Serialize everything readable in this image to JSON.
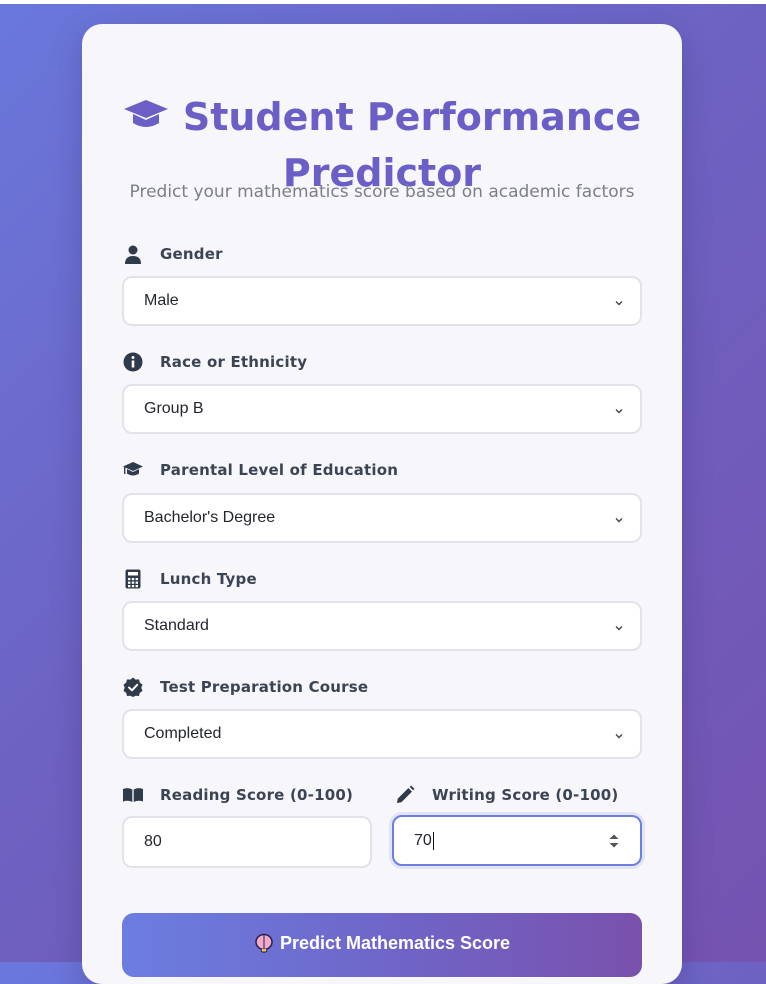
{
  "header": {
    "title_line1": "Student Performance",
    "title_line2": "Predictor",
    "title_icon": "graduation-cap-icon",
    "subtitle": "Predict your mathematics score based on academic factors"
  },
  "form": {
    "gender": {
      "label": "Gender",
      "value": "Male",
      "icon": "user-icon"
    },
    "race": {
      "label": "Race or Ethnicity",
      "value": "Group B",
      "icon": "info-circle-icon"
    },
    "parental_education": {
      "label": "Parental Level of Education",
      "value": "Bachelor's Degree",
      "icon": "graduation-cap-icon"
    },
    "lunch": {
      "label": "Lunch Type",
      "value": "Standard",
      "icon": "calculator-icon"
    },
    "test_prep": {
      "label": "Test Preparation Course",
      "value": "Completed",
      "icon": "check-badge-icon"
    },
    "reading_score": {
      "label": "Reading Score (0-100)",
      "value": "80",
      "icon": "book-open-icon"
    },
    "writing_score": {
      "label": "Writing Score (0-100)",
      "value": "70",
      "icon": "pencil-icon"
    }
  },
  "submit": {
    "label": "Predict Mathematics Score",
    "icon": "brain-icon"
  },
  "colors": {
    "accent": "#6a5fc6",
    "gradient_start": "#6b7ee0",
    "gradient_end": "#7a51ad"
  }
}
